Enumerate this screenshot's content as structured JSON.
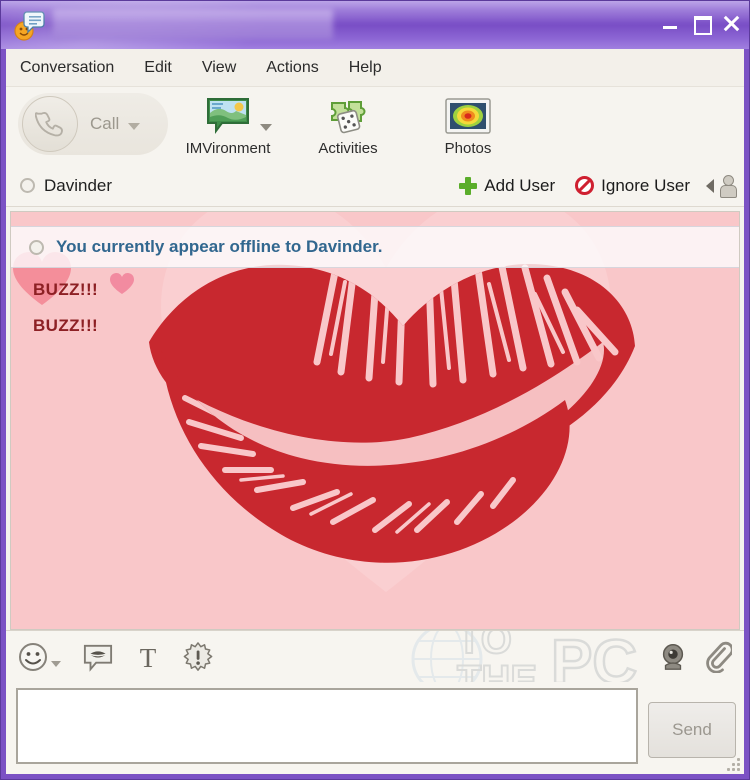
{
  "window": {
    "title": "",
    "title_redacted": true,
    "app_icon": "yahoo-messenger-icon",
    "controls": {
      "minimize": "Minimize",
      "maximize": "Maximize",
      "close": "Close"
    },
    "frame_color": "#7b52c4"
  },
  "menubar": {
    "items": [
      {
        "label": "Conversation"
      },
      {
        "label": "Edit"
      },
      {
        "label": "View"
      },
      {
        "label": "Actions"
      },
      {
        "label": "Help"
      }
    ]
  },
  "toolbar": {
    "call": {
      "label": "Call",
      "icon": "phone-icon",
      "disabled": true,
      "has_dropdown": true
    },
    "buttons": [
      {
        "label": "IMVironment",
        "icon": "imvironment-icon",
        "has_dropdown": true
      },
      {
        "label": "Activities",
        "icon": "activities-dice-icon",
        "has_dropdown": false
      },
      {
        "label": "Photos",
        "icon": "photos-icon",
        "has_dropdown": false
      }
    ]
  },
  "contactbar": {
    "contact_name": "Davinder",
    "contact_status": "offline",
    "status_icon": "offline-circle-icon",
    "add_user": {
      "label": "Add User",
      "icon": "green-plus-icon"
    },
    "ignore_user": {
      "label": "Ignore User",
      "icon": "red-ban-icon"
    },
    "collapse": {
      "icon": "chevron-left-icon"
    },
    "person": {
      "icon": "person-icon"
    }
  },
  "conversation": {
    "status_message": "You currently appear offline to Davinder.",
    "status_icon": "offline-circle-icon",
    "status_text_color": "#31678f",
    "background": {
      "name": "lips-kiss-imvironment",
      "base_color": "#f9c7c9",
      "lips_color": "#c8282f"
    },
    "messages": [
      {
        "text": "BUZZ!!!",
        "color": "#8d2024"
      },
      {
        "text": "BUZZ!!!",
        "color": "#8d2024"
      }
    ]
  },
  "composer_toolbar": {
    "left_buttons": [
      {
        "name": "emoticons",
        "icon": "smiley-icon",
        "has_dropdown": true
      },
      {
        "name": "audibles",
        "icon": "audible-lips-icon",
        "has_dropdown": false
      },
      {
        "name": "font",
        "icon": "font-t-icon",
        "has_dropdown": false
      },
      {
        "name": "buzz",
        "icon": "buzz-starburst-icon",
        "has_dropdown": false
      }
    ],
    "right_buttons": [
      {
        "name": "webcam",
        "icon": "webcam-icon"
      },
      {
        "name": "attach",
        "icon": "paperclip-icon"
      }
    ],
    "watermark": {
      "line1": "TO",
      "line2": "THE",
      "line3": "PC",
      "icon": "globe-icon"
    }
  },
  "input_area": {
    "message_value": "",
    "message_placeholder": "",
    "send_label": "Send",
    "send_disabled": true
  },
  "resize_grip": {
    "icon": "resize-grip-icon"
  }
}
